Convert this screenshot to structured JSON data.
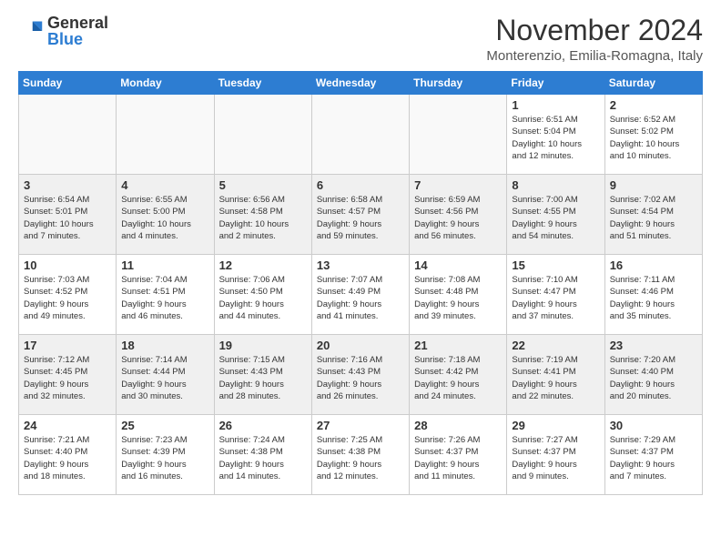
{
  "logo": {
    "general": "General",
    "blue": "Blue"
  },
  "header": {
    "month_year": "November 2024",
    "location": "Monterenzio, Emilia-Romagna, Italy"
  },
  "weekdays": [
    "Sunday",
    "Monday",
    "Tuesday",
    "Wednesday",
    "Thursday",
    "Friday",
    "Saturday"
  ],
  "weeks": [
    [
      {
        "day": "",
        "info": ""
      },
      {
        "day": "",
        "info": ""
      },
      {
        "day": "",
        "info": ""
      },
      {
        "day": "",
        "info": ""
      },
      {
        "day": "",
        "info": ""
      },
      {
        "day": "1",
        "info": "Sunrise: 6:51 AM\nSunset: 5:04 PM\nDaylight: 10 hours\nand 12 minutes."
      },
      {
        "day": "2",
        "info": "Sunrise: 6:52 AM\nSunset: 5:02 PM\nDaylight: 10 hours\nand 10 minutes."
      }
    ],
    [
      {
        "day": "3",
        "info": "Sunrise: 6:54 AM\nSunset: 5:01 PM\nDaylight: 10 hours\nand 7 minutes."
      },
      {
        "day": "4",
        "info": "Sunrise: 6:55 AM\nSunset: 5:00 PM\nDaylight: 10 hours\nand 4 minutes."
      },
      {
        "day": "5",
        "info": "Sunrise: 6:56 AM\nSunset: 4:58 PM\nDaylight: 10 hours\nand 2 minutes."
      },
      {
        "day": "6",
        "info": "Sunrise: 6:58 AM\nSunset: 4:57 PM\nDaylight: 9 hours\nand 59 minutes."
      },
      {
        "day": "7",
        "info": "Sunrise: 6:59 AM\nSunset: 4:56 PM\nDaylight: 9 hours\nand 56 minutes."
      },
      {
        "day": "8",
        "info": "Sunrise: 7:00 AM\nSunset: 4:55 PM\nDaylight: 9 hours\nand 54 minutes."
      },
      {
        "day": "9",
        "info": "Sunrise: 7:02 AM\nSunset: 4:54 PM\nDaylight: 9 hours\nand 51 minutes."
      }
    ],
    [
      {
        "day": "10",
        "info": "Sunrise: 7:03 AM\nSunset: 4:52 PM\nDaylight: 9 hours\nand 49 minutes."
      },
      {
        "day": "11",
        "info": "Sunrise: 7:04 AM\nSunset: 4:51 PM\nDaylight: 9 hours\nand 46 minutes."
      },
      {
        "day": "12",
        "info": "Sunrise: 7:06 AM\nSunset: 4:50 PM\nDaylight: 9 hours\nand 44 minutes."
      },
      {
        "day": "13",
        "info": "Sunrise: 7:07 AM\nSunset: 4:49 PM\nDaylight: 9 hours\nand 41 minutes."
      },
      {
        "day": "14",
        "info": "Sunrise: 7:08 AM\nSunset: 4:48 PM\nDaylight: 9 hours\nand 39 minutes."
      },
      {
        "day": "15",
        "info": "Sunrise: 7:10 AM\nSunset: 4:47 PM\nDaylight: 9 hours\nand 37 minutes."
      },
      {
        "day": "16",
        "info": "Sunrise: 7:11 AM\nSunset: 4:46 PM\nDaylight: 9 hours\nand 35 minutes."
      }
    ],
    [
      {
        "day": "17",
        "info": "Sunrise: 7:12 AM\nSunset: 4:45 PM\nDaylight: 9 hours\nand 32 minutes."
      },
      {
        "day": "18",
        "info": "Sunrise: 7:14 AM\nSunset: 4:44 PM\nDaylight: 9 hours\nand 30 minutes."
      },
      {
        "day": "19",
        "info": "Sunrise: 7:15 AM\nSunset: 4:43 PM\nDaylight: 9 hours\nand 28 minutes."
      },
      {
        "day": "20",
        "info": "Sunrise: 7:16 AM\nSunset: 4:43 PM\nDaylight: 9 hours\nand 26 minutes."
      },
      {
        "day": "21",
        "info": "Sunrise: 7:18 AM\nSunset: 4:42 PM\nDaylight: 9 hours\nand 24 minutes."
      },
      {
        "day": "22",
        "info": "Sunrise: 7:19 AM\nSunset: 4:41 PM\nDaylight: 9 hours\nand 22 minutes."
      },
      {
        "day": "23",
        "info": "Sunrise: 7:20 AM\nSunset: 4:40 PM\nDaylight: 9 hours\nand 20 minutes."
      }
    ],
    [
      {
        "day": "24",
        "info": "Sunrise: 7:21 AM\nSunset: 4:40 PM\nDaylight: 9 hours\nand 18 minutes."
      },
      {
        "day": "25",
        "info": "Sunrise: 7:23 AM\nSunset: 4:39 PM\nDaylight: 9 hours\nand 16 minutes."
      },
      {
        "day": "26",
        "info": "Sunrise: 7:24 AM\nSunset: 4:38 PM\nDaylight: 9 hours\nand 14 minutes."
      },
      {
        "day": "27",
        "info": "Sunrise: 7:25 AM\nSunset: 4:38 PM\nDaylight: 9 hours\nand 12 minutes."
      },
      {
        "day": "28",
        "info": "Sunrise: 7:26 AM\nSunset: 4:37 PM\nDaylight: 9 hours\nand 11 minutes."
      },
      {
        "day": "29",
        "info": "Sunrise: 7:27 AM\nSunset: 4:37 PM\nDaylight: 9 hours\nand 9 minutes."
      },
      {
        "day": "30",
        "info": "Sunrise: 7:29 AM\nSunset: 4:37 PM\nDaylight: 9 hours\nand 7 minutes."
      }
    ]
  ]
}
